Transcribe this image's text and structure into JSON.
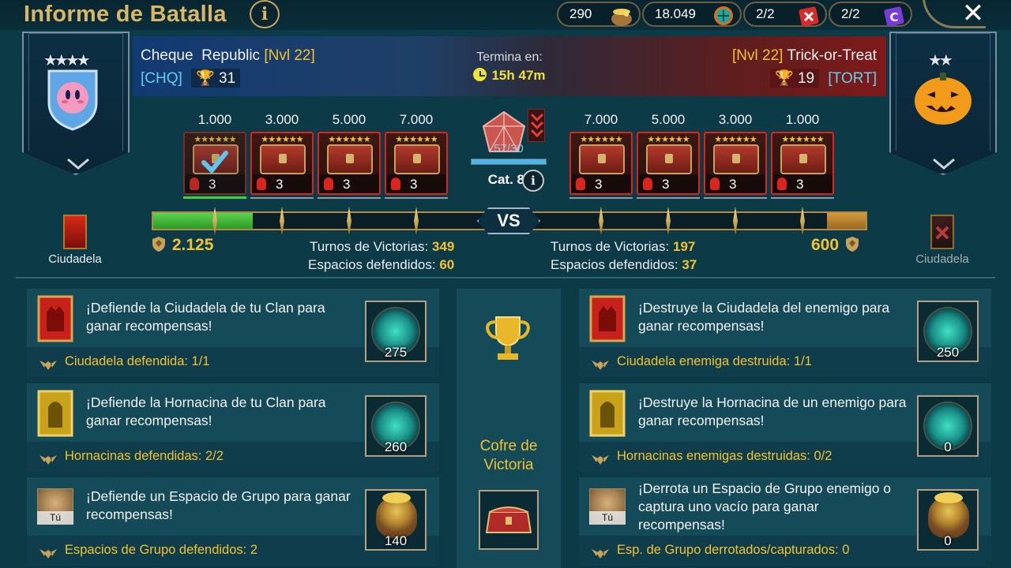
{
  "header": {
    "title": "Informe de Batalla",
    "info_icon": "info-icon",
    "close_icon": "close-icon"
  },
  "resources": [
    {
      "value": "290",
      "icon": "gold-bag-icon"
    },
    {
      "value": "18.049",
      "icon": "clan-orb-icon"
    },
    {
      "value": "2/2",
      "icon": "red-scroll-icon"
    },
    {
      "value": "2/2",
      "icon": "purple-scroll-icon"
    }
  ],
  "timer": {
    "label": "Termina en:",
    "value": "15h 47m",
    "icon": "clock-icon"
  },
  "left_clan": {
    "name": "Cheque  Republic",
    "level": "[Nvl 22]",
    "tag": "[CHQ]",
    "trophies": "31",
    "stars": 4,
    "score": "2.125",
    "turns_label": "Turnos de Victorias:",
    "turns": "349",
    "spaces_label": "Espacios defendidos:",
    "spaces": "60",
    "citadel_label": "Ciudadela",
    "emblem_icon": "kirby-shield-emblem"
  },
  "right_clan": {
    "name": "Trick-or-Treat",
    "level": "[Nvl 22]",
    "tag": "[TORT]",
    "trophies": "19",
    "stars": 2,
    "score": "600",
    "turns_label": "Turnos de Victorias:",
    "turns": "197",
    "spaces_label": "Espacios defendidos:",
    "spaces": "37",
    "citadel_label": "Ciudadela",
    "emblem_icon": "pumpkin-emblem"
  },
  "left_chests": [
    {
      "points": "1.000",
      "count": "3",
      "claimed": true
    },
    {
      "points": "3.000",
      "count": "3",
      "claimed": false
    },
    {
      "points": "5.000",
      "count": "3",
      "claimed": false
    },
    {
      "points": "7.000",
      "count": "3",
      "claimed": false
    }
  ],
  "right_chests": [
    {
      "points": "7.000",
      "count": "3"
    },
    {
      "points": "5.000",
      "count": "3"
    },
    {
      "points": "3.000",
      "count": "3"
    },
    {
      "points": "1.000",
      "count": "3"
    }
  ],
  "center": {
    "gem_progress": "57/30",
    "gem_fraction": 1.0,
    "category": "Cat. 8",
    "vs": "VS"
  },
  "track": {
    "left_fill_fraction": 0.14,
    "right_fill_fraction": 0.054
  },
  "left_tasks": [
    {
      "text": "¡Defiende la Ciudadela de tu Clan para ganar recompensas!",
      "status": "Ciudadela defendida: 1/1",
      "reward": "275",
      "reward_icon": "clan-orb-icon",
      "task_icon": "citadel-icon"
    },
    {
      "text": "¡Defiende la Hornacina de tu Clan para ganar recompensas!",
      "status": "Hornacinas defendidas: 2/2",
      "reward": "260",
      "reward_icon": "clan-orb-icon",
      "task_icon": "stronghold-icon"
    },
    {
      "text": "¡Defiende un Espacio de Grupo para ganar recompensas!",
      "status": "Espacios de Grupo defendidos: 2",
      "reward": "140",
      "reward_icon": "gold-bag-icon",
      "task_icon": "champion-portrait-icon",
      "badge": "Tú"
    }
  ],
  "right_tasks": [
    {
      "text": "¡Destruye la Ciudadela del enemigo para ganar recompensas!",
      "status": "Ciudadela enemiga destruida: 1/1",
      "reward": "250",
      "reward_icon": "clan-orb-icon",
      "task_icon": "citadel-icon"
    },
    {
      "text": "¡Destruye la Hornacina de un enemigo para ganar recompensas!",
      "status": "Hornacinas enemigas destruidas: 0/2",
      "reward": "0",
      "reward_icon": "clan-orb-icon",
      "task_icon": "stronghold-icon"
    },
    {
      "text": "¡Derrota un Espacio de Grupo enemigo o captura uno vacío para ganar recompensas!",
      "status": "Esp. de Grupo derrotados/capturados: 0",
      "reward": "0",
      "reward_icon": "gold-bag-icon",
      "task_icon": "champion-portrait-icon",
      "badge": "Tú"
    }
  ],
  "victory_chest": {
    "label": "Cofre de Victoria",
    "icon": "trophy-icon"
  },
  "colors": {
    "gold": "#f2c230",
    "cyan": "#5fd1ef",
    "green": "#3fd23a",
    "red": "#d9251b",
    "bg": "#0d3a47"
  }
}
